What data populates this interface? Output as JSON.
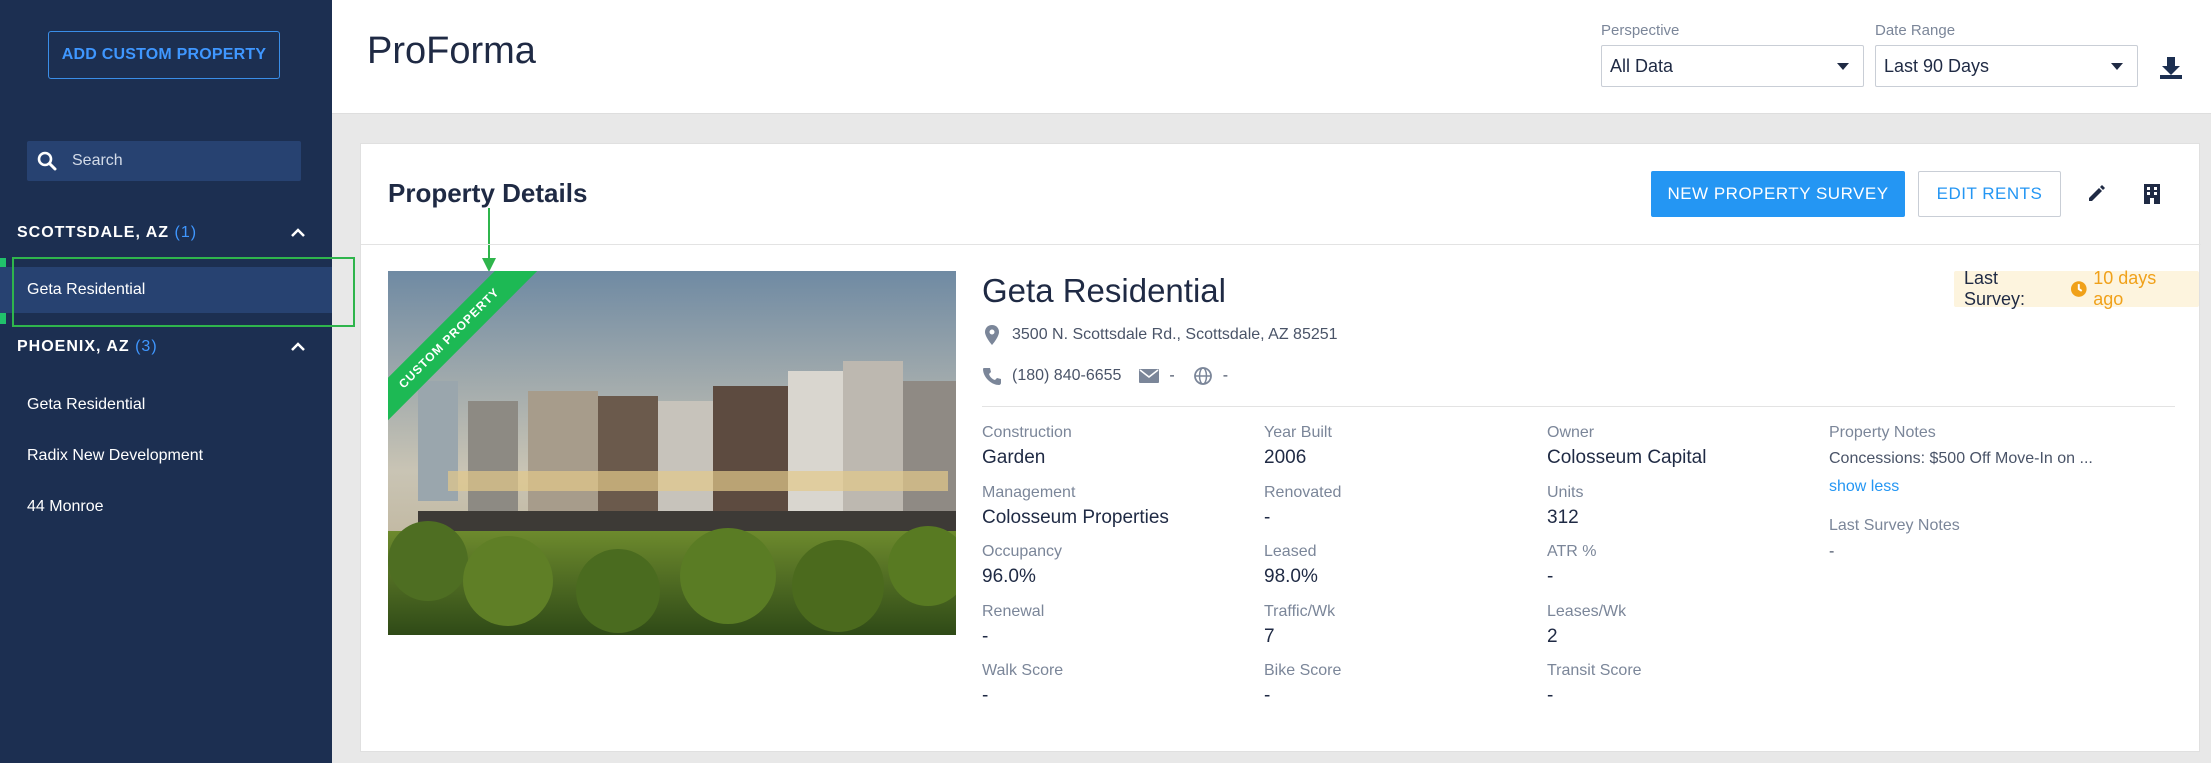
{
  "sidebar": {
    "add_button": "ADD CUSTOM PROPERTY",
    "search_placeholder": "Search",
    "groups": [
      {
        "name": "SCOTTSDALE, AZ",
        "count": "(1)",
        "items": [
          "Geta Residential"
        ]
      },
      {
        "name": "PHOENIX, AZ",
        "count": "(3)",
        "items": [
          "Geta Residential",
          "Radix New Development",
          "44 Monroe"
        ]
      }
    ]
  },
  "header": {
    "title": "ProForma",
    "perspective_label": "Perspective",
    "perspective_value": "All Data",
    "date_range_label": "Date Range",
    "date_range_value": "Last 90 Days"
  },
  "card": {
    "title": "Property Details",
    "new_survey_button": "NEW PROPERTY SURVEY",
    "edit_rents_button": "EDIT RENTS",
    "ribbon": "CUSTOM PROPERTY"
  },
  "property": {
    "name": "Geta Residential",
    "last_survey_label": "Last Survey:",
    "last_survey_value": "10 days ago",
    "address": "3500 N. Scottsdale Rd., Scottsdale, AZ 85251",
    "phone": "(180) 840-6655",
    "email": "-",
    "website": "-"
  },
  "stats": {
    "construction": {
      "label": "Construction",
      "value": "Garden"
    },
    "management": {
      "label": "Management",
      "value": "Colosseum Properties"
    },
    "occupancy": {
      "label": "Occupancy",
      "value": "96.0%"
    },
    "renewal": {
      "label": "Renewal",
      "value": "-"
    },
    "walk_score": {
      "label": "Walk Score",
      "value": "-"
    },
    "year_built": {
      "label": "Year Built",
      "value": "2006"
    },
    "renovated": {
      "label": "Renovated",
      "value": "-"
    },
    "leased": {
      "label": "Leased",
      "value": "98.0%"
    },
    "traffic": {
      "label": "Traffic/Wk",
      "value": "7"
    },
    "bike_score": {
      "label": "Bike Score",
      "value": "-"
    },
    "owner": {
      "label": "Owner",
      "value": "Colosseum Capital"
    },
    "units": {
      "label": "Units",
      "value": "312"
    },
    "atr": {
      "label": "ATR %",
      "value": "-"
    },
    "leases": {
      "label": "Leases/Wk",
      "value": "2"
    },
    "transit_score": {
      "label": "Transit Score",
      "value": "-"
    }
  },
  "notes": {
    "property_notes_label": "Property Notes",
    "property_notes_text": "Concessions: $500 Off Move-In on ...",
    "show_less": "show less",
    "last_survey_notes_label": "Last Survey Notes",
    "last_survey_notes_text": "-"
  },
  "colors": {
    "sidebar_bg": "#1c2f51",
    "accent_blue": "#2496f3",
    "custom_green": "#1db954",
    "survey_orange": "#f0a11a"
  }
}
